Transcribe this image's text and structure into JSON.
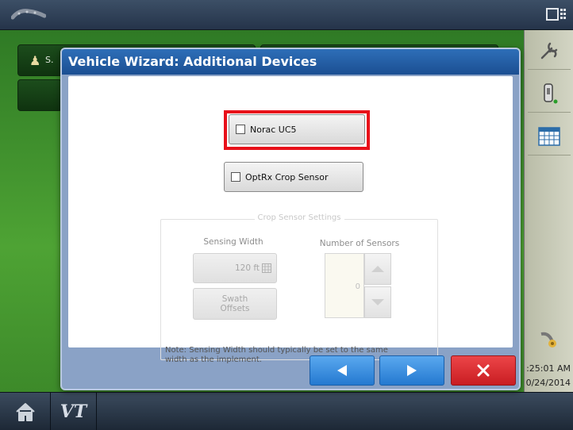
{
  "app": {
    "top_bar": {
      "gps_icon": "gps-antenna-icon",
      "display_icon": "display-layout-icon"
    },
    "background": {
      "tile_label": "S."
    }
  },
  "right_toolbar": {
    "items": [
      {
        "name": "wrench-icon"
      },
      {
        "name": "device-icon"
      },
      {
        "name": "grid-table-icon"
      },
      {
        "name": "satellite-dish-icon"
      }
    ],
    "time": ":25:01 AM",
    "date": "0/24/2014"
  },
  "bottom_bar": {
    "home_icon": "home-icon",
    "vt_label": "VT"
  },
  "dialog": {
    "title": "Vehicle Wizard:  Additional Devices",
    "options": [
      {
        "label": "Norac UC5",
        "checked": false,
        "highlighted": true
      },
      {
        "label": "OptRx Crop Sensor",
        "checked": false,
        "highlighted": false
      }
    ],
    "crop_sensor_settings": {
      "legend": "Crop Sensor Settings",
      "sensing_width_label": "Sensing Width",
      "sensing_width_value": "120 ft",
      "swath_offsets_label_line1": "Swath",
      "swath_offsets_label_line2": "Offsets",
      "number_of_sensors_label": "Number of Sensors",
      "number_of_sensors_value": "0",
      "note_line1": "Note: Sensing Width should typically be set to the same",
      "note_line2": "width as the implement."
    },
    "buttons": {
      "back": "back-arrow-icon",
      "next": "next-arrow-icon",
      "cancel": "close-icon"
    }
  },
  "colors": {
    "title_bar": "#1b4f92",
    "highlight": "#e8101a",
    "nav_blue": "#2479d0",
    "cancel_red": "#c91d22"
  }
}
